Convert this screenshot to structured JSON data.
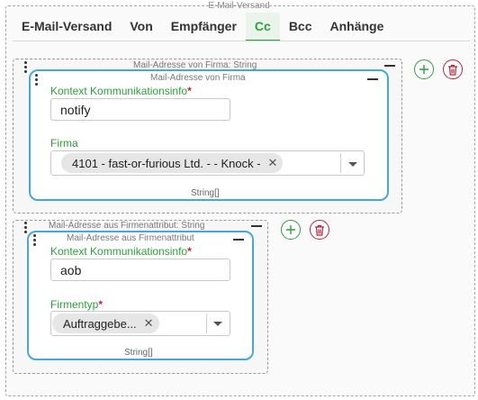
{
  "outer": {
    "legend": "E-Mail-Versand"
  },
  "tabs": [
    {
      "label": "E-Mail-Versand"
    },
    {
      "label": "Von"
    },
    {
      "label": "Empfänger"
    },
    {
      "label": "Cc",
      "active": true
    },
    {
      "label": "Bcc"
    },
    {
      "label": "Anhänge"
    }
  ],
  "list1": {
    "legend": "Mail-Adresse von Firma: String",
    "card_legend": "Mail-Adresse von Firma",
    "field1": {
      "label": "Kontext Kommunikationsinfo",
      "required": "*",
      "value": "notify"
    },
    "field2": {
      "label": "Firma",
      "chip": "4101 - fast-or-furious Ltd. - - Knock -"
    },
    "type_note": "String[]"
  },
  "list2": {
    "legend": "Mail-Adresse aus Firmenattribut: String",
    "card_legend": "Mail-Adresse aus Firmenattribut",
    "field1": {
      "label": "Kontext Kommunikationsinfo",
      "required": "*",
      "value": "aob"
    },
    "field2": {
      "label": "Firmentyp",
      "required": "*",
      "chip": "Auftraggebe..."
    },
    "type_note": "String[]"
  },
  "icons": {
    "add": "plus-circle-icon",
    "delete": "trash-icon",
    "remove_chip": "close-icon",
    "dropdown": "caret-down-icon",
    "drag": "drag-handle-icon",
    "collapse": "minus-icon"
  },
  "colors": {
    "accent_green": "#2e9e3c",
    "card_border_blue": "#45a8d8",
    "delete_red": "#b0243a",
    "required_red": "#d0203a"
  }
}
